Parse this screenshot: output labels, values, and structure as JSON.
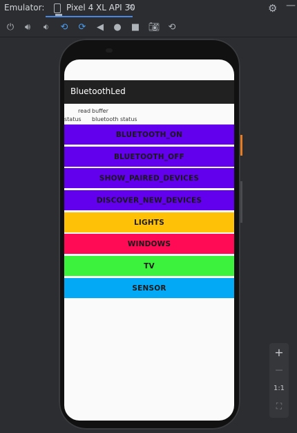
{
  "emulator": {
    "label": "Emulator:",
    "tab_label": "Pixel 4 XL API 30",
    "tab_close": "×",
    "settings_icon": "gear-icon",
    "minimize": "—"
  },
  "toolbar": {
    "icons": [
      "power-icon",
      "volume-up-icon",
      "volume-down-icon",
      "rotate-left-icon",
      "rotate-right-icon",
      "back-icon",
      "home-icon",
      "overview-icon",
      "camera-icon",
      "snapshot-icon"
    ]
  },
  "app": {
    "title": "BluetoothLed",
    "read_label": "read",
    "buffer_label": "buffer",
    "status_label": "status",
    "bluetooth_status_label": "bluetooth status"
  },
  "buttons": [
    {
      "label": "BLUETOOTH_ON",
      "color": "#6200ee"
    },
    {
      "label": "BLUETOOTH_OFF",
      "color": "#6200ee"
    },
    {
      "label": "SHOW_PAIRED_DEVICES",
      "color": "#6200ee"
    },
    {
      "label": "DISCOVER_NEW_DEVICES",
      "color": "#6200ee"
    },
    {
      "label": "LIGHTS",
      "color": "#ffc107"
    },
    {
      "label": "WINDOWS",
      "color": "#ff0a54"
    },
    {
      "label": "TV",
      "color": "#3df23d"
    },
    {
      "label": "SENSOR",
      "color": "#03a9f4"
    }
  ],
  "zoom": {
    "plus": "+",
    "minus": "—",
    "one_to_one": "1:1",
    "fit_icon": "fit-screen-icon"
  }
}
